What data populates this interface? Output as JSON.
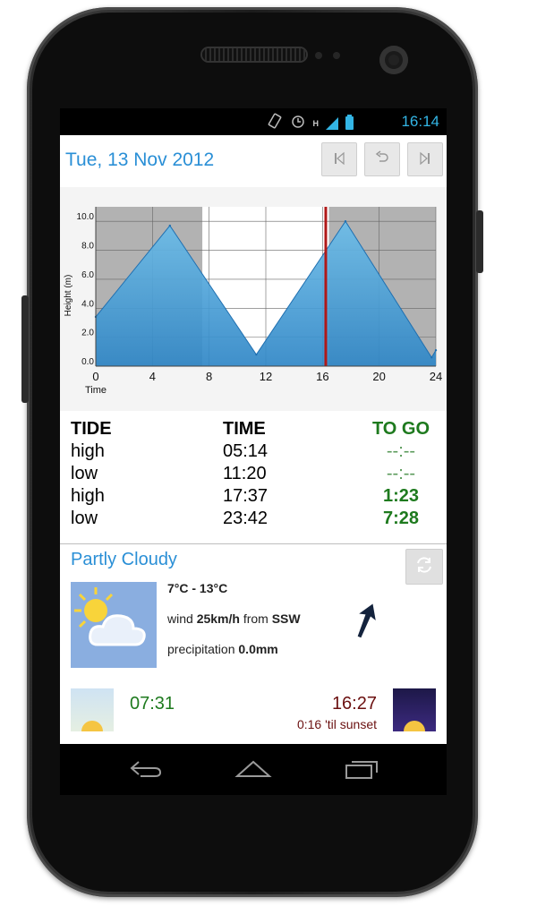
{
  "status": {
    "time": "16:14",
    "h_label": "H"
  },
  "header": {
    "date": "Tue, 13 Nov 2012",
    "prev_icon": "skip-back-icon",
    "today_icon": "undo-icon",
    "next_icon": "skip-forward-icon"
  },
  "chart_data": {
    "type": "area",
    "ylabel": "Height (m)",
    "xlabel": "Time",
    "xlim": [
      0,
      24
    ],
    "ylim": [
      0,
      11
    ],
    "x_ticks": [
      0,
      4,
      8,
      12,
      16,
      20,
      24
    ],
    "y_ticks": [
      "0.0",
      "2.0",
      "4.0",
      "6.0",
      "8.0",
      "10.0"
    ],
    "y_tick_values": [
      0,
      2,
      4,
      6,
      8,
      10
    ],
    "series": [
      {
        "x": [
          0,
          5.23,
          11.33,
          17.62,
          23.7,
          24
        ],
        "y": [
          3.4,
          9.7,
          0.8,
          10.0,
          0.6,
          1.1
        ]
      }
    ],
    "night_shading": [
      [
        0,
        7.52
      ],
      [
        16.45,
        24
      ]
    ],
    "current_time": 16.23,
    "grid": true
  },
  "tides": {
    "headers": {
      "tide": "TIDE",
      "time": "TIME",
      "to_go": "TO GO"
    },
    "rows": [
      {
        "tide": "high",
        "time": "05:14",
        "to_go": "--:--"
      },
      {
        "tide": "low",
        "time": "11:20",
        "to_go": "--:--"
      },
      {
        "tide": "high",
        "time": "17:37",
        "to_go": "1:23"
      },
      {
        "tide": "low",
        "time": "23:42",
        "to_go": "7:28"
      }
    ]
  },
  "weather": {
    "condition": "Partly Cloudy",
    "temp_range": "7°C - 13°C",
    "wind_prefix": "wind",
    "wind_speed": "25km/h",
    "wind_from": "from",
    "wind_dir": "SSW",
    "precip_prefix": "precipitation",
    "precip_value": "0.0mm",
    "icon": "partly-cloudy-icon",
    "refresh_icon": "refresh-icon"
  },
  "sun": {
    "sunrise": "07:31",
    "sunset": "16:27",
    "sunset_countdown": "0:16 'til sunset"
  },
  "colors": {
    "accent_blue": "#2a8fd6",
    "green": "#1e7a1e",
    "sunset_red": "#6b1010",
    "chart_fill": "#4aa6dc",
    "now_line": "#b01818"
  }
}
